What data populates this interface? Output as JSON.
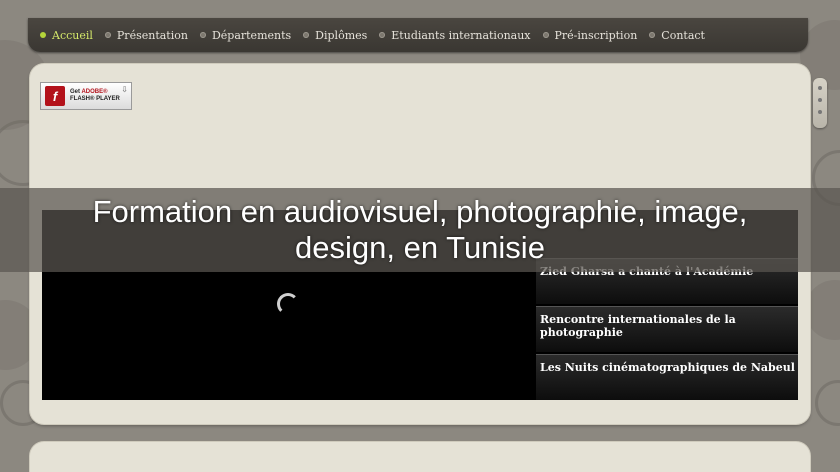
{
  "nav": {
    "items": [
      {
        "label": "Accueil",
        "active": true
      },
      {
        "label": "Présentation",
        "active": false
      },
      {
        "label": "Départements",
        "active": false
      },
      {
        "label": "Diplômes",
        "active": false
      },
      {
        "label": "Etudiants internationaux",
        "active": false
      },
      {
        "label": "Pré-inscription",
        "active": false
      },
      {
        "label": "Contact",
        "active": false
      }
    ]
  },
  "flash_badge": {
    "line1_prefix": "Get ",
    "line1_brand": "ADOBE®",
    "line2": "FLASH® PLAYER",
    "logo_letter": "f"
  },
  "slideshow": {
    "items": [
      "Zied Gharsa a chanté à l'Académie",
      "Rencontre internationales de la photographie",
      "Les Nuits cinématographiques de Nabeul"
    ],
    "loading": true
  },
  "title": "Formation en audiovisuel, photographie, image, design, en Tunisie",
  "colors": {
    "background": "#8c8880",
    "nav_bg": "#3a3732",
    "panel_bg": "#e5e2d6",
    "active_nav": "#d4e86a"
  }
}
